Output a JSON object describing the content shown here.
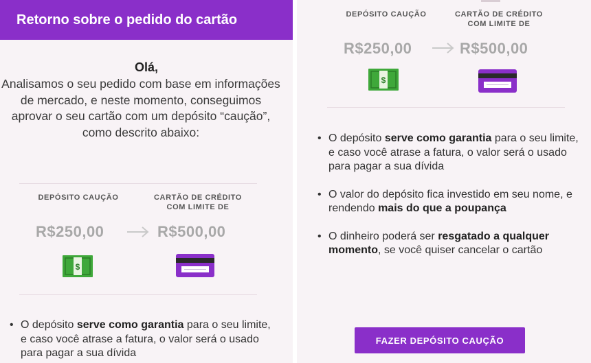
{
  "header": {
    "title": "Retorno sobre o pedido do cartão"
  },
  "message": {
    "greeting": "Olá,",
    "intro": "Analisamos o seu pedido com base em informações de mercado, e neste momento, conseguimos aprovar o seu cartão com um depósito “caução”, como descrito abaixo:"
  },
  "offer": {
    "deposit_caption": "DEPÓSITO CAUÇÃO",
    "card_caption_line1": "CARTÃO DE CRÉDITO",
    "card_caption_line2": "COM LIMITE DE",
    "deposit_amount": "R$250,00",
    "card_limit": "R$500,00",
    "money_icon": "money-bill-icon",
    "card_icon": "credit-card-icon"
  },
  "bullets": {
    "b1_pre": "O depósito ",
    "b1_bold": "serve como garantia",
    "b1_post": " para o seu limite, e caso você atrase a fatura, o valor será o usado para pagar a sua dívida",
    "b2_pre": "O valor do depósito fica investido em seu nome, e rendendo ",
    "b2_bold": "mais do que a poupança",
    "b3_pre": "O dinheiro poderá ser ",
    "b3_bold": "resgatado a qualquer momento",
    "b3_post": ", se você quiser cancelar o cartão"
  },
  "cta": {
    "label": "FAZER DEPÓSITO CAUÇÃO"
  },
  "colors": {
    "brand": "#8a2fc9",
    "money_green": "#3fa83a",
    "amount_gray": "#a8a8a8"
  }
}
